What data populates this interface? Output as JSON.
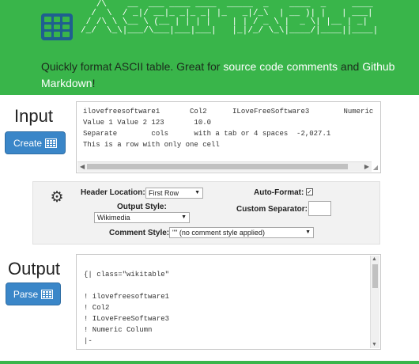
{
  "header": {
    "ascii_title": "   /\\    __  ___ ____ ____  _____  _    ____  _     ____\n  /  \\  / _|/ __|_ _|_ _| |_   _|/_\\  | __ )| |   | ___|\n / /\\ \\ \\__ \\ (__ | | | |    | | / _ \\ |  _ \\| |__ | _|\n/_/  \\_\\|___/\\___|___|___|   |_|/_/ \\_\\|____/|____||____|",
    "tagline_start": "Quickly format ASCII table. Great for ",
    "link_comments": "source code comments",
    "tagline_and": " and ",
    "link_markdown": "Github Markdown",
    "tagline_end": "!"
  },
  "input": {
    "title": "Input",
    "button_label": "Create",
    "text": "ilovefreesoftware1       Col2      ILoveFreeSoftware3        Numeric\nValue 1 Value 2 123       10.0\nSeparate        cols      with a tab or 4 spaces  -2,027.1\nThis is a row with only one cell"
  },
  "options": {
    "header_location_label": "Header Location:",
    "header_location_value": "First Row",
    "auto_format_label": "Auto-Format:",
    "auto_format_checked": true,
    "output_style_label": "Output Style:",
    "output_style_value": "Wikimedia",
    "custom_separator_label": "Custom Separator:",
    "custom_separator_value": "",
    "comment_style_label": "Comment Style:",
    "comment_style_value": "\"\" (no comment style applied)"
  },
  "output": {
    "title": "Output",
    "button_label": "Parse",
    "text": "{| class=\"wikitable\"\n\n! ilovefreesoftware1\n! Col2\n! ILoveFreeSoftware3\n! Numeric Column\n|-"
  },
  "colors": {
    "header_green": "#39b54a",
    "button_blue": "#3a86c8",
    "link_white": "#ffffff"
  },
  "icons": {
    "logo": "table-icon",
    "button": "table-icon",
    "options": "gear-icon"
  }
}
